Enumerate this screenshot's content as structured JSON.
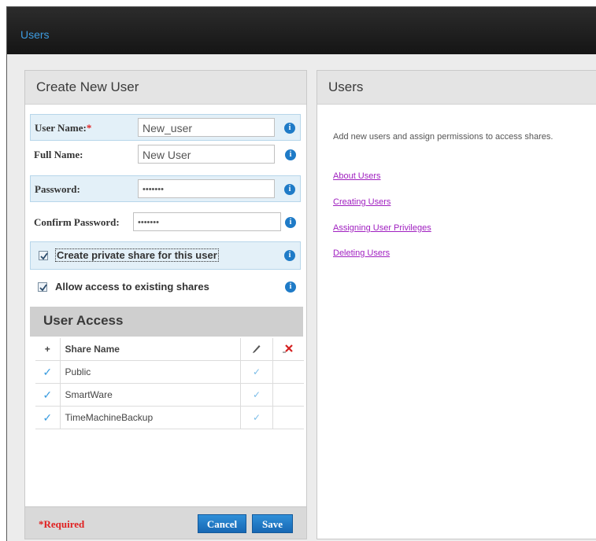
{
  "window": {
    "title": "Users"
  },
  "create": {
    "heading": "Create New User",
    "username_label": "User Name:",
    "required_mark": "*",
    "username_value": "New_user",
    "fullname_label": "Full Name:",
    "fullname_value": "New User",
    "password_label": "Password:",
    "password_value": "•••••••",
    "confirm_label": "Confirm Password:",
    "confirm_value": "•••••••",
    "private_share_label": "Create private share for this user",
    "private_share_checked": true,
    "allow_access_label": "Allow access to existing shares",
    "allow_access_checked": true,
    "info_glyph": "i"
  },
  "access": {
    "heading": "User Access",
    "add_glyph": "+",
    "column_share": "Share Name",
    "rows": [
      {
        "share": "Public",
        "selected": true,
        "write": true
      },
      {
        "share": "SmartWare",
        "selected": true,
        "write": true
      },
      {
        "share": "TimeMachineBackup",
        "selected": true,
        "write": true
      }
    ]
  },
  "footer": {
    "required_note": "*Required",
    "cancel_label": "Cancel",
    "save_label": "Save"
  },
  "help": {
    "heading": "Users",
    "description": "Add new users and assign permissions to access shares.",
    "links": [
      "About Users",
      "Creating Users",
      "Assigning User Privileges",
      "Deleting Users"
    ]
  },
  "colors": {
    "accent": "#1f7bc7",
    "link": "#a020c0",
    "required": "#e02020",
    "topbar": "#1c1c1c"
  },
  "icons": [
    "info-icon",
    "checkbox-checked-icon",
    "plus-icon",
    "pencil-icon",
    "delete-x-icon",
    "checkmark-icon"
  ]
}
